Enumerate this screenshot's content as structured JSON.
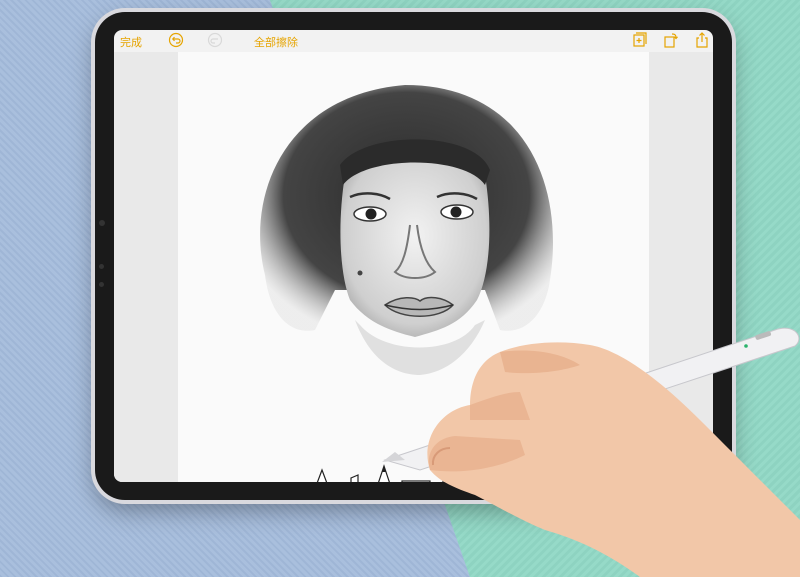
{
  "toolbar": {
    "done_label": "完成",
    "clear_all_label": "全部擦除"
  },
  "icons": {
    "undo": "undo-icon",
    "redo": "redo-icon",
    "new_page": "add-page-icon",
    "rotate": "rotate-icon",
    "share": "share-icon"
  },
  "colors": {
    "accent": "#e6a400",
    "tablet_frame": "#1a1a1a",
    "pen_body": "#f1f1f3"
  }
}
